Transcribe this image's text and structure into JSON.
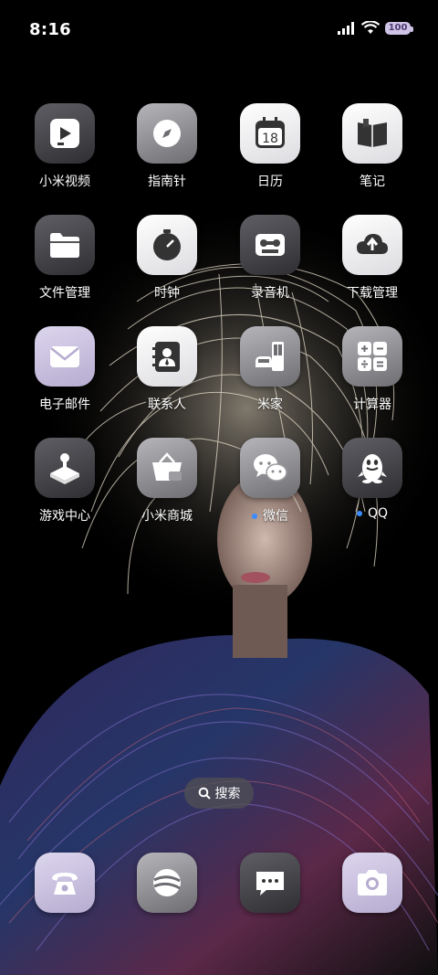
{
  "status_bar": {
    "time": "8:16",
    "battery": "100"
  },
  "apps": [
    {
      "label": "小米视频",
      "icon": "video-play-icon",
      "style": "dark"
    },
    {
      "label": "指南针",
      "icon": "compass-icon",
      "style": "grey"
    },
    {
      "label": "日历",
      "icon": "calendar-icon",
      "style": "white",
      "date": "18"
    },
    {
      "label": "笔记",
      "icon": "notebook-icon",
      "style": "white"
    },
    {
      "label": "文件管理",
      "icon": "folder-icon",
      "style": "dark"
    },
    {
      "label": "时钟",
      "icon": "clock-icon",
      "style": "white"
    },
    {
      "label": "录音机",
      "icon": "recorder-icon",
      "style": "dark"
    },
    {
      "label": "下载管理",
      "icon": "download-cloud-icon",
      "style": "white"
    },
    {
      "label": "电子邮件",
      "icon": "mail-icon",
      "style": "lav"
    },
    {
      "label": "联系人",
      "icon": "contacts-icon",
      "style": "white"
    },
    {
      "label": "米家",
      "icon": "home-sofa-icon",
      "style": "grey"
    },
    {
      "label": "计算器",
      "icon": "calculator-icon",
      "style": "grey"
    },
    {
      "label": "游戏中心",
      "icon": "game-center-icon",
      "style": "dark"
    },
    {
      "label": "小米商城",
      "icon": "shopping-basket-icon",
      "style": "grey"
    },
    {
      "label": "微信",
      "icon": "wechat-icon",
      "style": "grey",
      "new": true
    },
    {
      "label": "QQ",
      "icon": "qq-penguin-icon",
      "style": "dark",
      "new": true
    }
  ],
  "search": {
    "label": "搜索"
  },
  "dock": [
    {
      "icon": "phone-icon",
      "style": "lav"
    },
    {
      "icon": "browser-globe-icon",
      "style": "grey"
    },
    {
      "icon": "messages-icon",
      "style": "dark"
    },
    {
      "icon": "camera-icon",
      "style": "lav"
    }
  ]
}
